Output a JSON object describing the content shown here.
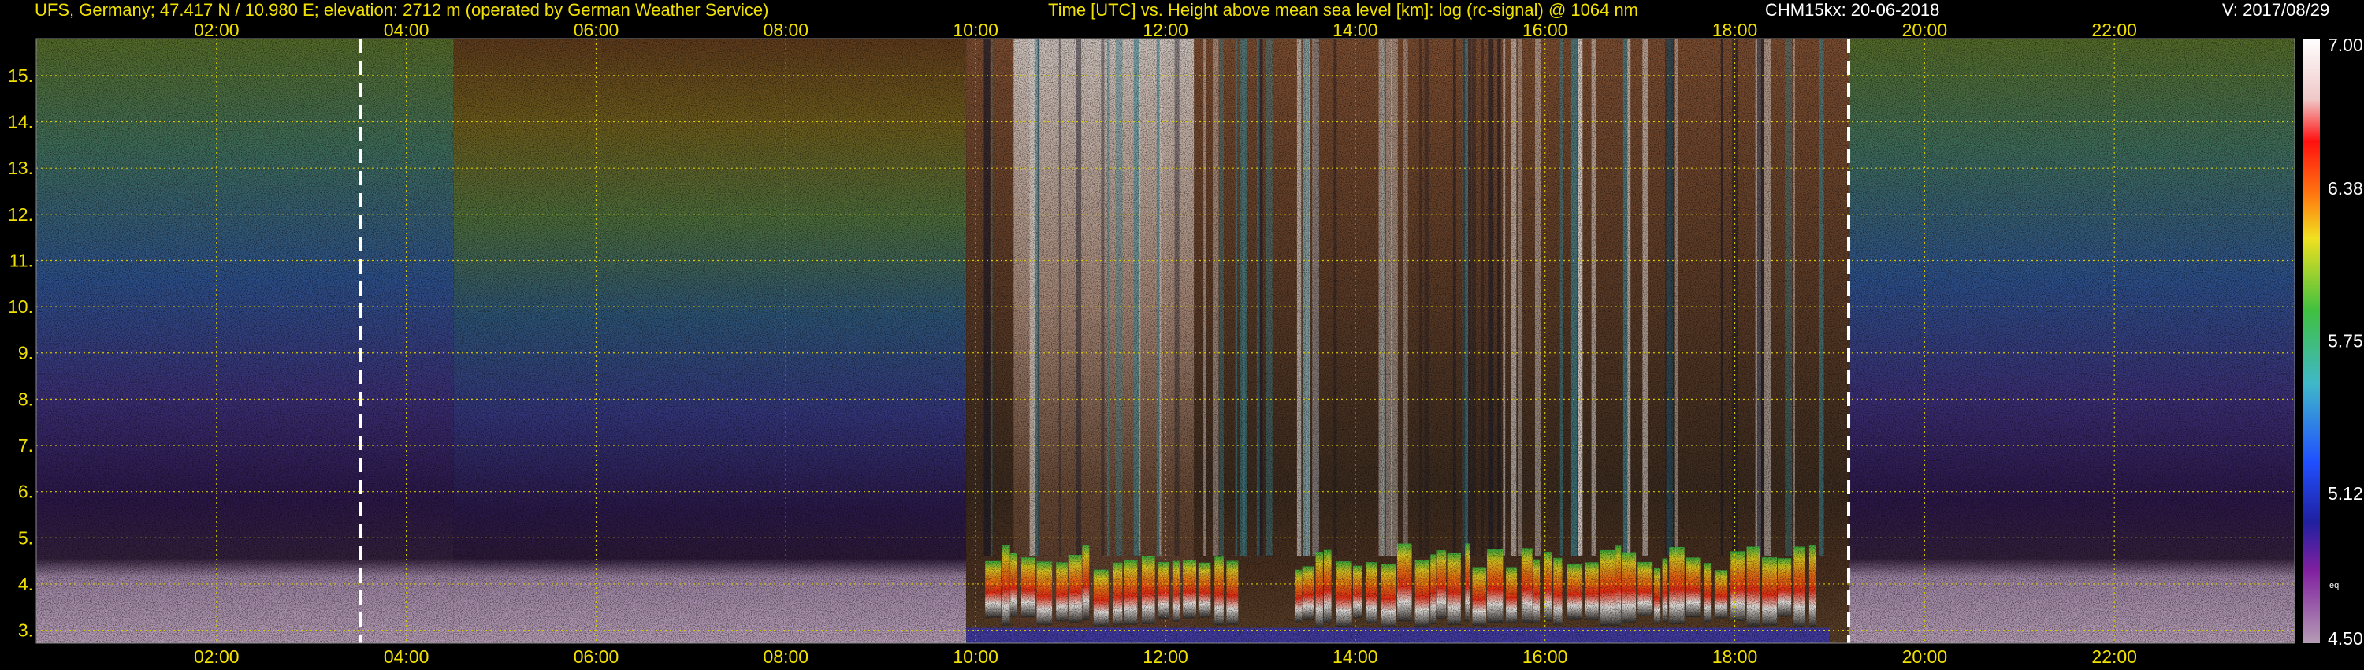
{
  "header": {
    "station": "UFS, Germany; 47.417 N / 10.980 E; elevation: 2712 m  (operated by German Weather Service)",
    "plot_description": "Time [UTC] vs. Height above mean sea level [km]: log (rc-signal) @ 1064 nm",
    "instrument_date": "CHM15kx: 20-06-2018",
    "version": "V: 2017/08/29"
  },
  "colors": {
    "axis_text": "#f0e000",
    "grid": "#d8c800",
    "background": "#000000",
    "marker_lines": "#ffffff"
  },
  "chart_data": {
    "type": "heatmap",
    "title": "Time [UTC] vs. Height above mean sea level [km]: log (rc-signal) @ 1064 nm",
    "xlabel": "Time [UTC]",
    "ylabel": "Height above mean sea level [km]",
    "xlim": [
      0.1,
      23.9
    ],
    "ylim": [
      2.72,
      15.8
    ],
    "x_ticks": [
      "02:00",
      "04:00",
      "06:00",
      "08:00",
      "10:00",
      "12:00",
      "14:00",
      "16:00",
      "18:00",
      "20:00",
      "22:00"
    ],
    "x_tick_hours": [
      2,
      4,
      6,
      8,
      10,
      12,
      14,
      16,
      18,
      20,
      22
    ],
    "y_ticks": [
      "3.",
      "4.",
      "5.",
      "6.",
      "7.",
      "8.",
      "9.",
      "10.",
      "11.",
      "12.",
      "13.",
      "14.",
      "15."
    ],
    "y_tick_values": [
      3,
      4,
      5,
      6,
      7,
      8,
      9,
      10,
      11,
      12,
      13,
      14,
      15
    ],
    "grid": true,
    "marker_lines_hours": [
      3.52,
      19.2
    ],
    "colorbar": {
      "min": 4.5,
      "max": 7.0,
      "tick_labels": [
        "7.00",
        "6.38",
        "5.75",
        "5.12",
        "4.50"
      ],
      "tick_values": [
        7.0,
        6.38,
        5.75,
        5.12,
        4.5
      ],
      "unit_label": "eq"
    },
    "features": [
      {
        "name": "daytime high-noise period",
        "start": "10:00",
        "end": "19:00"
      },
      {
        "name": "convective cloud layer",
        "height_km": [
          3.0,
          4.8
        ],
        "start": "10:00",
        "end": "18:45"
      },
      {
        "name": "below-cloud-base signal",
        "height_km": [
          2.8,
          4.0
        ]
      }
    ]
  }
}
